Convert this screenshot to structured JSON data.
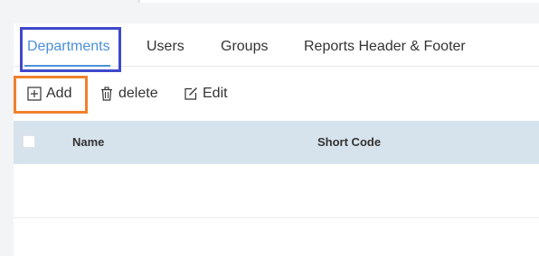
{
  "tabs": [
    {
      "label": "Departments",
      "active": true
    },
    {
      "label": "Users",
      "active": false
    },
    {
      "label": "Groups",
      "active": false
    },
    {
      "label": "Reports Header & Footer",
      "active": false
    }
  ],
  "toolbar": {
    "add_label": "Add",
    "delete_label": "delete",
    "edit_label": "Edit"
  },
  "table": {
    "columns": [
      "Name",
      "Short Code"
    ],
    "rows": []
  },
  "icons": {
    "add": "plus-square-icon",
    "delete": "trash-icon",
    "edit": "edit-icon"
  },
  "colors": {
    "accent": "#4a90d9",
    "highlight_tab": "#3f48cc",
    "highlight_add": "#f0812e",
    "table_header_bg": "#d7e3ec"
  }
}
